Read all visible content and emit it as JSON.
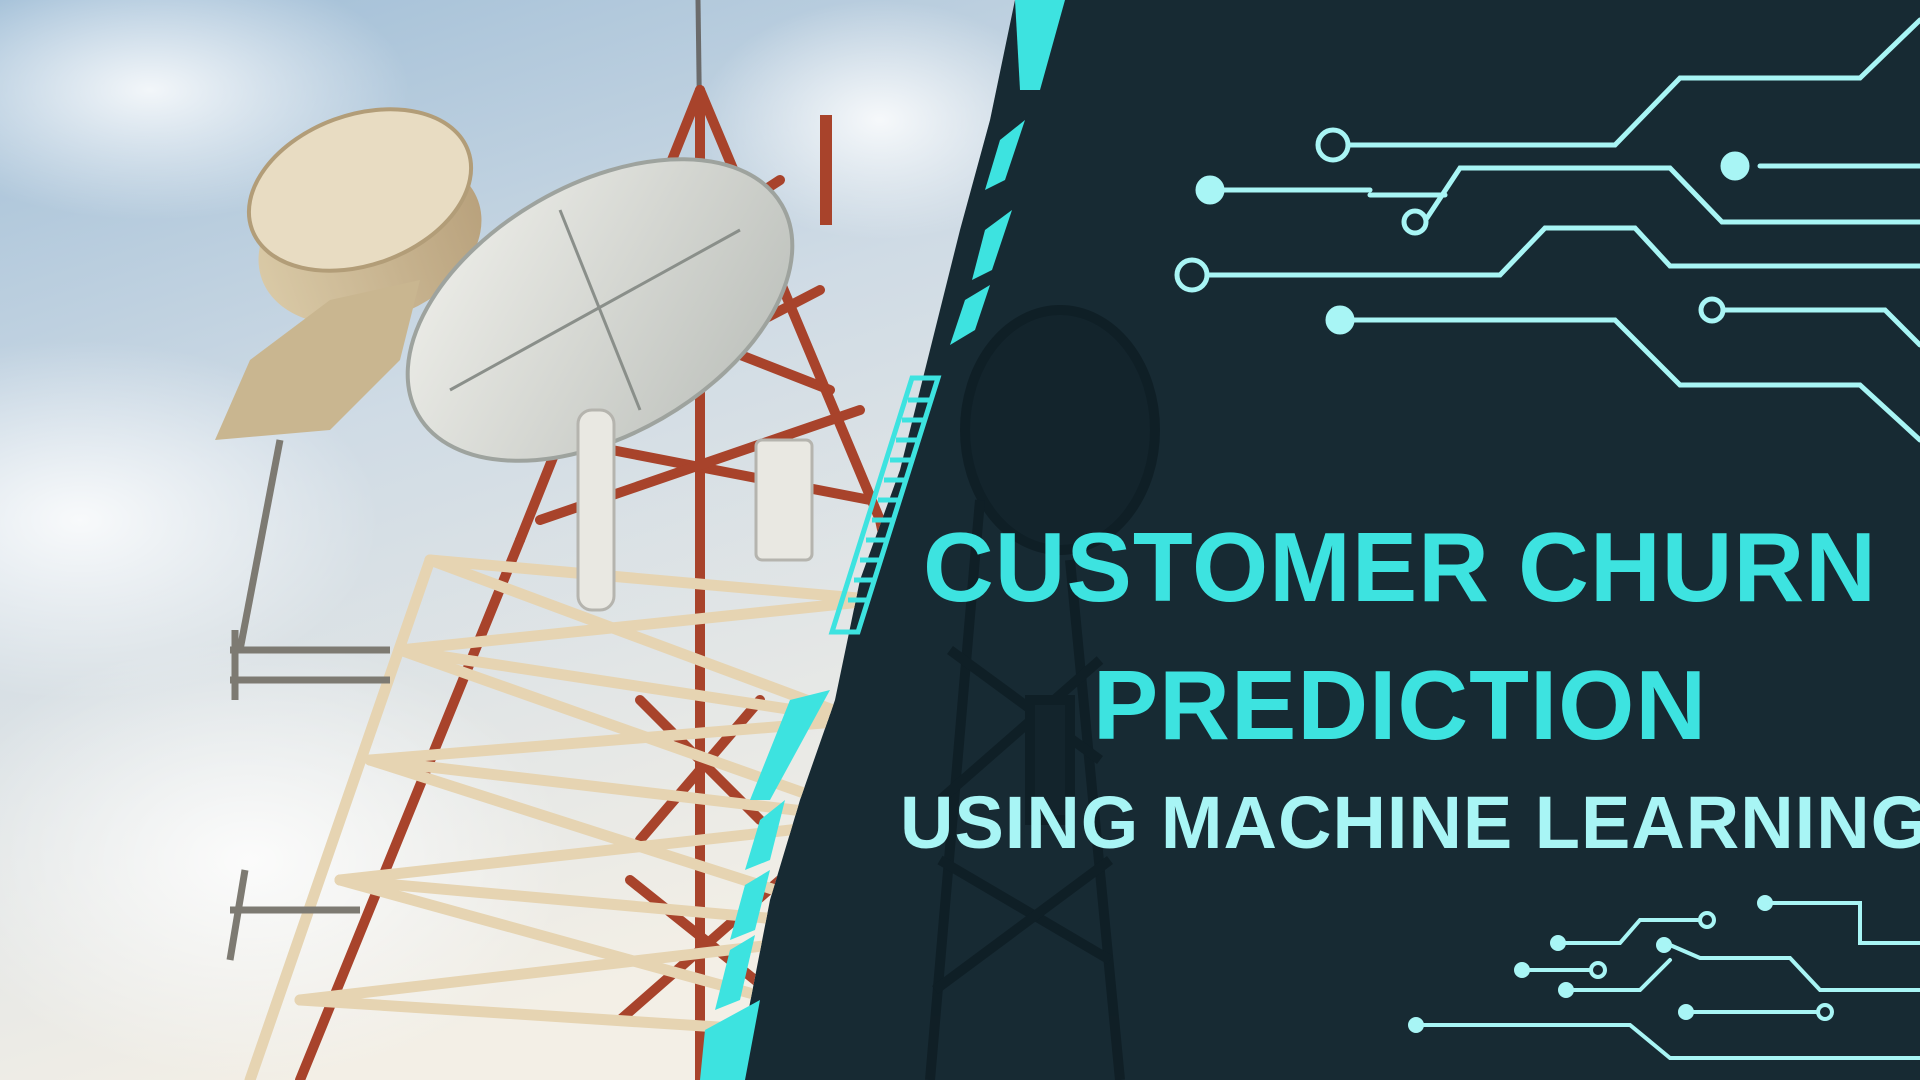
{
  "headline": {
    "line1": "CUSTOMER CHURN",
    "line2": "PREDICTION",
    "line3": "USING MACHINE LEARNING"
  },
  "colors": {
    "panel_background": "#172a33",
    "accent_cyan": "#3de3e0",
    "light_cyan": "#a8f5f5",
    "tower_red": "#a8432b",
    "tower_cream": "#e6d4b2",
    "sky_blue": "#a9c7dd"
  },
  "illustration": {
    "photo": "telecom-tower-with-antennas-and-dishes",
    "decoration": "circuit-board-traces"
  }
}
